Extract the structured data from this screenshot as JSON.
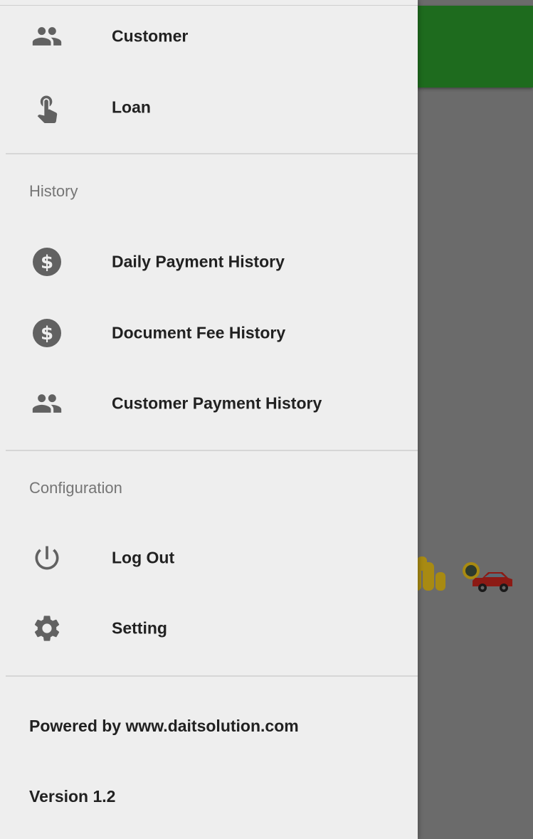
{
  "colors": {
    "app_bar": "#1e6b1e",
    "drawer_bg": "#eeeeee",
    "scrim": "#6b6b6b",
    "icon": "#616161",
    "text": "#212121",
    "section_header": "#757575"
  },
  "drawer": {
    "main_items": [
      {
        "label": "Customer",
        "icon": "people-icon"
      },
      {
        "label": "Loan",
        "icon": "touch-icon"
      }
    ],
    "history": {
      "header": "History",
      "items": [
        {
          "label": "Daily Payment History",
          "icon": "dollar-icon"
        },
        {
          "label": "Document Fee History",
          "icon": "dollar-icon"
        },
        {
          "label": "Customer Payment History",
          "icon": "people-icon"
        }
      ]
    },
    "configuration": {
      "header": "Configuration",
      "items": [
        {
          "label": "Log Out",
          "icon": "power-icon"
        },
        {
          "label": "Setting",
          "icon": "gear-icon"
        }
      ]
    },
    "footer": {
      "powered_by": "Powered by www.daitsolution.com",
      "version": "Version 1.2"
    }
  }
}
